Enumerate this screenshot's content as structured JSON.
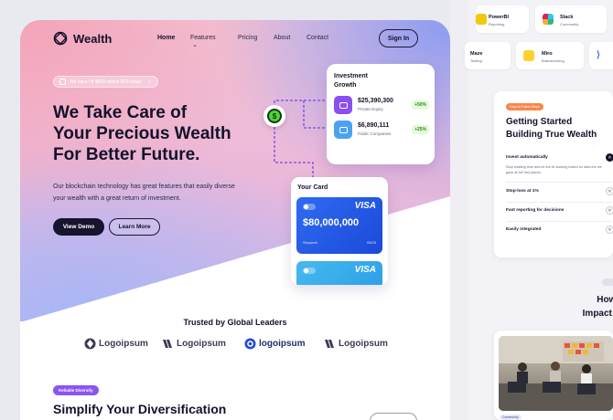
{
  "colors": {
    "accent_green": "#7df05a",
    "dark": "#14112b",
    "visa_blue": "#2f6bf1",
    "visa_light": "#46b9ee",
    "badge_purple": "#8a55f0",
    "badge_orange": "#f7874a"
  },
  "nav": {
    "brand": "Wealth",
    "links": [
      "Home",
      "Features",
      "Pricing",
      "About",
      "Contact"
    ],
    "signin": "Sign In"
  },
  "hero": {
    "pill": "We have hit $550 million ROI today",
    "title_line1": "We Take Care of",
    "title_line2": "Your Precious Wealth",
    "title_line3": "For Better Future.",
    "description": "Our blockchain technology has great features that easily diverse your wealth with a great return of investment.",
    "btn_demo": "View Demo",
    "btn_more": "Learn More"
  },
  "investment": {
    "title": "Investment Growth",
    "rows": [
      {
        "amount": "$25,390,300",
        "label": "Private Equity",
        "badge": "+50%"
      },
      {
        "amount": "$6,890,111",
        "label": "Public Companies",
        "badge": "+25%"
      }
    ]
  },
  "your_card": {
    "title": "Your Card",
    "brand": "VISA",
    "amount": "$80,000,000",
    "holder": "Shoyeeb",
    "expiry": "09/25",
    "brand2": "VISA"
  },
  "trusted": {
    "title": "Trusted by Global Leaders",
    "logos": [
      "Logoipsum",
      "Logoipsum",
      "logoipsum",
      "Logoipsum"
    ]
  },
  "diversify": {
    "badge": "Reliable Diversify",
    "title_prefix": "Simplify Your ",
    "title_highlight": "Diversification"
  },
  "integrations": [
    {
      "name": "PowerBI",
      "sub": "Reporting",
      "icon": "powerbi-icon"
    },
    {
      "name": "Slack",
      "sub": "Community",
      "icon": "slack-icon"
    },
    {
      "name": "Maze",
      "sub": "Testing",
      "icon": "maze-icon"
    },
    {
      "name": "Miro",
      "sub": "Brainstorming",
      "icon": "miro-icon"
    }
  ],
  "faq": {
    "badge": "Easy to Follow Steps",
    "title_line1": "Getting Started",
    "title_prefix": "Building ",
    "title_highlight": "True Wealth",
    "items": [
      {
        "q": "Invest automatically",
        "open": true
      },
      {
        "q": "Stop-loss at 1%",
        "open": false
      },
      {
        "q": "Fast reporting for decisions",
        "open": false
      },
      {
        "q": "Easily integrated",
        "open": false
      }
    ],
    "answer": "Stop wasting time and let the AI working based on data the we gave at the first places."
  },
  "impact": {
    "line1": "How Ou",
    "line2": "Impact to T"
  },
  "photo": {
    "chip": "Community"
  }
}
